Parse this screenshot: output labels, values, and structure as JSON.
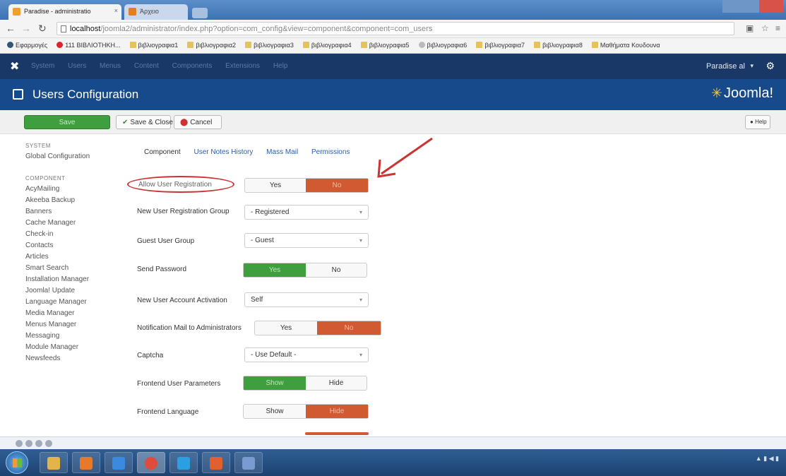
{
  "browser": {
    "active_tab_title": "Paradise - administratio",
    "inactive_tab_title": "Άρχειο",
    "url_host": "localhost",
    "url_rest": "/joomla2/administrator/index.php?option=com_config&view=component&component=com_users",
    "bookmarks": [
      {
        "label": "Εφαρμογές",
        "icon": "apps-icon"
      },
      {
        "label": "111 ΒΙΒΛΙΟΤΗΚΗ...",
        "icon": "youtube-icon"
      },
      {
        "label": "βιβλιογραφια1",
        "icon": "folder-icon"
      },
      {
        "label": "βιβλιογραφια2",
        "icon": "folder-icon"
      },
      {
        "label": "βιβλιογραφια3",
        "icon": "folder-icon"
      },
      {
        "label": "βιβλιογραφια4",
        "icon": "folder-icon"
      },
      {
        "label": "βιβλιογραφια5",
        "icon": "folder-icon"
      },
      {
        "label": "βιβλιογραφια6",
        "icon": "wikipedia-icon"
      },
      {
        "label": "βιβλιογραφια7",
        "icon": "folder-icon"
      },
      {
        "label": "βιβλιογραφια8",
        "icon": "folder-icon"
      },
      {
        "label": "Μαθήματα Κουδουνα",
        "icon": "folder-icon"
      }
    ]
  },
  "joomla_nav": {
    "menu": [
      "System",
      "Users",
      "Menus",
      "Content",
      "Components",
      "Extensions",
      "Help"
    ],
    "user_name": "Paradise al"
  },
  "header": {
    "title": "Users Configuration",
    "brand": "Joomla!"
  },
  "toolbar": {
    "save": "Save",
    "save_close": "Save & Close",
    "cancel": "Cancel",
    "help": "Help"
  },
  "sidebar": {
    "system_heading": "SYSTEM",
    "system_items": [
      "Global Configuration"
    ],
    "component_heading": "COMPONENT",
    "component_items": [
      "AcyMailing",
      "Akeeba Backup",
      "Banners",
      "Cache Manager",
      "Check-in",
      "Contacts",
      "Articles",
      "Smart Search",
      "Installation Manager",
      "Joomla! Update",
      "Language Manager",
      "Media Manager",
      "Menus Manager",
      "Messaging",
      "Module Manager",
      "Newsfeeds"
    ]
  },
  "tabs": [
    "Component",
    "User Notes History",
    "Mass Mail",
    "Permissions"
  ],
  "form": {
    "allow_registration": {
      "label": "Allow User Registration",
      "yes": "Yes",
      "no": "No"
    },
    "new_user_group": {
      "label": "New User Registration Group",
      "value": "- Registered"
    },
    "guest_group": {
      "label": "Guest User Group",
      "value": "- Guest"
    },
    "send_password": {
      "label": "Send Password",
      "yes": "Yes",
      "no": "No"
    },
    "account_activation": {
      "label": "New User Account Activation",
      "value": "Self"
    },
    "notification_mail": {
      "label": "Notification Mail to Administrators",
      "yes": "Yes",
      "no": "No"
    },
    "captcha": {
      "label": "Captcha",
      "value": "- Use Default -"
    },
    "frontend_params": {
      "label": "Frontend User Parameters",
      "show": "Show",
      "hide": "Hide"
    },
    "frontend_language": {
      "label": "Frontend Language",
      "show": "Show",
      "hide": "Hide"
    }
  },
  "colors": {
    "joomla_nav": "#1a3867",
    "joomla_header": "#174a8a",
    "toggle_red": "#d25a33",
    "toggle_green": "#3f9f3f",
    "annotation": "#cc3333"
  }
}
